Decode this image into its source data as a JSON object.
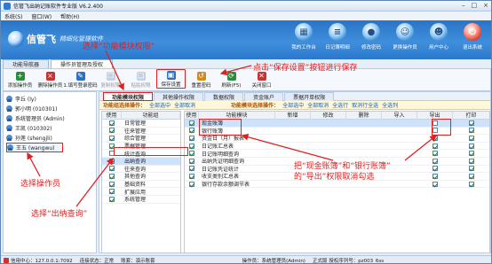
{
  "titlebar": {
    "title": "信管飞出纳记账软件专业版 V6.2.400",
    "controls": [
      "–",
      "□",
      "×"
    ]
  },
  "menubar": {
    "items": [
      "系统(S)",
      "窗口(W)",
      "帮助(H)"
    ]
  },
  "banner": {
    "brand": "信管飞",
    "slogan": "精细化管理软件",
    "tiles": [
      {
        "label": "我的工作台",
        "icon": "desk-icon",
        "glyph": "▦"
      },
      {
        "label": "日记簿明细",
        "icon": "journal-icon",
        "glyph": "≡"
      },
      {
        "label": "修改密码",
        "icon": "lock-icon",
        "glyph": "●"
      },
      {
        "label": "更换操作员",
        "icon": "user-switch-icon",
        "glyph": "☺"
      },
      {
        "label": "用户中心",
        "icon": "user-center-icon",
        "glyph": "☻"
      },
      {
        "label": "退出系统",
        "icon": "power-icon",
        "glyph": "⏻"
      }
    ]
  },
  "window_tabs": [
    "功能导航器",
    "操作员管理及授权"
  ],
  "toolbar": {
    "buttons": [
      {
        "label": "添加操作员",
        "glyph": "+",
        "color": "#2e8b3d",
        "disabled": false
      },
      {
        "label": "删除操作员",
        "glyph": "×",
        "color": "#c83232",
        "disabled": false
      },
      {
        "label": "1.填写登录密码",
        "glyph": "✎",
        "color": "#2e6fbf",
        "disabled": false
      },
      {
        "label": "复制权限",
        "glyph": "❐",
        "color": "#8aa4c2",
        "disabled": true
      },
      {
        "label": "粘贴权限",
        "glyph": "❏",
        "color": "#8aa4c2",
        "disabled": true
      },
      {
        "label": "保存设置",
        "glyph": "▣",
        "color": "#2e6fbf",
        "disabled": false,
        "highlight": true
      },
      {
        "label": "重置密码",
        "glyph": "↺",
        "color": "#d08a20",
        "disabled": false
      },
      {
        "label": "刷新(F5)",
        "glyph": "⟳",
        "color": "#2e8b3d",
        "disabled": false
      },
      {
        "label": "关闭窗口",
        "glyph": "✕",
        "color": "#c83232",
        "disabled": false
      }
    ]
  },
  "operators": [
    {
      "name": "李丘 (ly)"
    },
    {
      "name": "郭小明 (010301)"
    },
    {
      "name": "系统管理员 (Admin)"
    },
    {
      "name": "王凯 (010302)"
    },
    {
      "name": "孙莲 (shengjli)"
    },
    {
      "name": "王五 (wangwu)",
      "selected": true
    }
  ],
  "subtabs": [
    {
      "label": "功能模块权限",
      "active": true
    },
    {
      "label": "其他操作权限"
    },
    {
      "label": "数据权限"
    },
    {
      "label": "资金账户"
    },
    {
      "label": "票据开单权限"
    }
  ],
  "ops_left": {
    "title": "功能组选择操作：",
    "links": [
      "全部选中",
      "全部取消"
    ]
  },
  "ops_right": {
    "title": "功能模块选择操作：",
    "links": [
      "全部选中",
      "全部取消",
      "全选行",
      "取消行全选",
      "全选列"
    ]
  },
  "func_groups": {
    "headers": [
      "使用",
      "功能组"
    ],
    "rows": [
      {
        "name": "日常管理",
        "checked": true
      },
      {
        "name": "往来管理",
        "checked": true
      },
      {
        "name": "综合管理",
        "checked": true
      },
      {
        "name": "票据管理",
        "checked": true
      },
      {
        "name": "统计查询",
        "checked": false
      },
      {
        "name": "出纳查询",
        "checked": true,
        "selected": true
      },
      {
        "name": "往来查询",
        "checked": true
      },
      {
        "name": "其他查询",
        "checked": true
      },
      {
        "name": "基础资料",
        "checked": true
      },
      {
        "name": "扩展应用",
        "checked": true
      },
      {
        "name": "系统管理",
        "checked": true
      }
    ]
  },
  "func_modules": {
    "headers": [
      "使用",
      "功能模块",
      "新增",
      "修改",
      "删除",
      "导入",
      "导出",
      "打印"
    ],
    "rows": [
      {
        "name": "现金账簿",
        "use": true,
        "export": false,
        "print": true,
        "selected": true
      },
      {
        "name": "银行账簿",
        "use": true,
        "export": false,
        "print": true
      },
      {
        "name": "资金日（月）报表",
        "use": true,
        "export": true,
        "print": true
      },
      {
        "name": "日记账汇总表",
        "use": true,
        "export": true,
        "print": true
      },
      {
        "name": "日记账明细查询",
        "use": true,
        "export": true,
        "print": true
      },
      {
        "name": "出纳凭证明细查询",
        "use": true,
        "export": true,
        "print": true
      },
      {
        "name": "日记账凭证统计",
        "use": true,
        "export": true,
        "print": true
      },
      {
        "name": "收支类别汇总表",
        "use": true,
        "export": true,
        "print": true
      },
      {
        "name": "银行存款余额调节表",
        "use": true,
        "export": true,
        "print": true
      }
    ]
  },
  "annotations": {
    "save": "点击“保存设置”按钮进行保存",
    "module_tab": "选择“功能模块权限”",
    "operator": "选择操作员",
    "query": "选择“出纳查询”",
    "export": "把“现金账簿”和“银行账簿”\n的“导出”权限取消勾选"
  },
  "statusbar": {
    "server": "信用中心：127.0.0.1:7092",
    "state": "连接状态：正常",
    "ledger": "账套：演示账套",
    "operator": "操作员：系统管理员(Admin)",
    "version": "正式版 授权序列号：pz003_6ss"
  },
  "colors": {
    "accent": "#2e7bd6",
    "annotation": "#e02020",
    "banner": "#2a73c6"
  }
}
